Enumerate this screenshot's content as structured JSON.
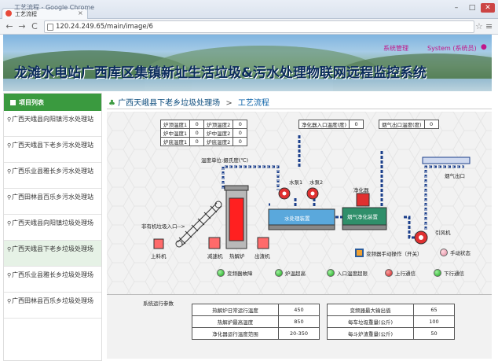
{
  "window": {
    "title": "工艺流程 - Google Chrome",
    "tab_title": "工艺流程",
    "tab_close": "×",
    "controls": [
      "–",
      "□",
      "✕"
    ]
  },
  "address": {
    "back": "←",
    "forward": "→",
    "reload": "C",
    "url": "120.24.249.65/main/image/6",
    "bookmark": "☆",
    "menu": "≡"
  },
  "header": {
    "title": "龙滩水电站广西库区集镇新址生活垃圾&污水处理物联网远程监控系统",
    "system_manage": "系统管理",
    "user": "System (系统员)"
  },
  "sidebar": {
    "heading": "项目列表",
    "items": [
      {
        "label": "广西天峨县向阳镇污水处理站"
      },
      {
        "label": "广西天峨县下老乡污水处理站"
      },
      {
        "label": "广西乐业县雅长乡污水处理站"
      },
      {
        "label": "广西田林县百乐乡污水处理站"
      },
      {
        "label": "广西天峨县向阳镇垃圾处理场"
      },
      {
        "label": "广西天峨县下老乡垃圾处理场"
      },
      {
        "label": "广西乐业县雅长乡垃圾处理场"
      },
      {
        "label": "广西田林县百乐乡垃圾处理场"
      }
    ],
    "active_index": 5
  },
  "breadcrumb": {
    "site": "广西天峨县下老乡垃圾处理场",
    "separator": ">",
    "page": "工艺流程"
  },
  "temps": {
    "rows": [
      {
        "l1": "炉顶温度1",
        "v1": "0",
        "l2": "炉顶温度2",
        "v2": "0"
      },
      {
        "l1": "炉中温度1",
        "v1": "0",
        "l2": "炉中温度2",
        "v2": "0"
      },
      {
        "l1": "炉底温度1",
        "v1": "0",
        "l2": "炉底温度2",
        "v2": "0"
      }
    ],
    "purifier_inlet_label": "净化器入口温度(度)",
    "purifier_inlet_value": "0",
    "flue_outlet_label": "烟气出口温度(度)",
    "flue_outlet_value": "0",
    "unit_note": "温度单位:摄氏度(℃)"
  },
  "process": {
    "pump1": "水泵1",
    "pump2": "水泵2",
    "purifier": "净化器",
    "flue_outlet": "烟气出口",
    "feeder_inlet": "非有机垃圾入口-->",
    "water_unit": "水处理装置",
    "smoke_unit": "烟气净化装置",
    "fan": "引风机",
    "loader": "上料机",
    "reducer": "减速机",
    "incinerator": "热解炉",
    "ash_out": "出渣机"
  },
  "legend": {
    "manual": "变频器手动操作（开关）",
    "manual_state": "手动状态",
    "inverter_fault": "变频器故障",
    "furnace_temp_high": "炉温超高",
    "inlet_temp_high": "入口温度超限",
    "up_comm": "上行通信",
    "down_comm": "下行通信"
  },
  "params": {
    "heading": "系统运行参数",
    "left": [
      {
        "label": "热解炉日常运行温度",
        "value": "450"
      },
      {
        "label": "热解炉最高温度",
        "value": "850"
      },
      {
        "label": "净化器运行温度范围",
        "value": "20-350"
      }
    ],
    "right": [
      {
        "label": "变频器最大输出值",
        "value": "65"
      },
      {
        "label": "每车垃圾重量(公斤)",
        "value": "100"
      },
      {
        "label": "每斗炉渣重量(公斤)",
        "value": "50"
      }
    ]
  },
  "colors": {
    "sidebar_header": "#3a9a3f",
    "magenta_link": "#c0168a",
    "furnace_red": "#ff2020",
    "water_blue": "#5aa8dc"
  }
}
